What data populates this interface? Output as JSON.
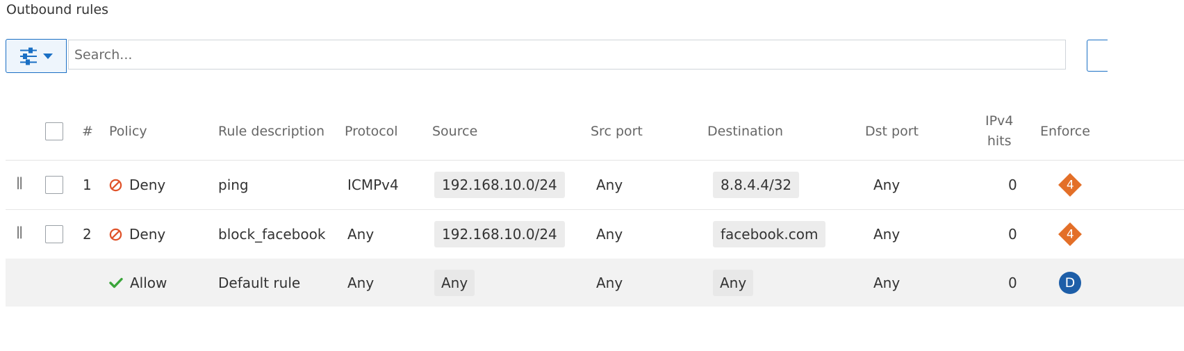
{
  "section_title": "Outbound rules",
  "search": {
    "placeholder": "Search..."
  },
  "columns": {
    "number": "#",
    "policy": "Policy",
    "rule_description": "Rule description",
    "protocol": "Protocol",
    "source": "Source",
    "src_port": "Src port",
    "destination": "Destination",
    "dst_port": "Dst port",
    "ipv4_hits_line1": "IPv4",
    "ipv4_hits_line2": "hits",
    "enforce": "Enforce"
  },
  "rows": [
    {
      "number": "1",
      "policy": "Deny",
      "description": "ping",
      "protocol": "ICMPv4",
      "source": "192.168.10.0/24",
      "src_port": "Any",
      "destination": "8.8.4.4/32",
      "dst_port": "Any",
      "hits": "0",
      "enforce_badge": "4"
    },
    {
      "number": "2",
      "policy": "Deny",
      "description": "block_facebook",
      "protocol": "Any",
      "source": "192.168.10.0/24",
      "src_port": "Any",
      "destination": "facebook.com",
      "dst_port": "Any",
      "hits": "0",
      "enforce_badge": "4"
    },
    {
      "number": "",
      "policy": "Allow",
      "description": "Default rule",
      "protocol": "Any",
      "source": "Any",
      "src_port": "Any",
      "destination": "Any",
      "dst_port": "Any",
      "hits": "0",
      "enforce_badge": "D"
    }
  ],
  "colors": {
    "accent": "#1a6fc4",
    "deny": "#e0532a",
    "allow": "#3aa53a",
    "badge_orange": "#e36f28",
    "badge_blue": "#1d5ea8"
  },
  "icons": {
    "filter": "sliders-icon",
    "dropdown": "caret-down-icon",
    "deny": "deny-icon",
    "allow": "check-icon",
    "drag": "drag-handle-icon"
  }
}
